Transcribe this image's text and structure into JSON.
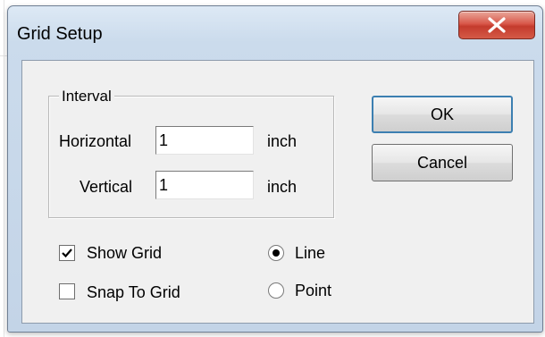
{
  "dialog": {
    "title": "Grid Setup",
    "close_icon": "close-x-icon",
    "close_color": "#d9584a"
  },
  "interval": {
    "group_label": "Interval",
    "horizontal": {
      "label": "Horizontal",
      "value": "1",
      "unit": "inch"
    },
    "vertical": {
      "label": "Vertical",
      "value": "1",
      "unit": "inch"
    }
  },
  "buttons": {
    "ok_label": "OK",
    "cancel_label": "Cancel"
  },
  "options": {
    "show_grid": {
      "label": "Show Grid",
      "checked": true
    },
    "snap_to_grid": {
      "label": "Snap To Grid",
      "checked": false
    }
  },
  "grid_style": {
    "line": {
      "label": "Line",
      "selected": true
    },
    "point": {
      "label": "Point",
      "selected": false
    }
  }
}
